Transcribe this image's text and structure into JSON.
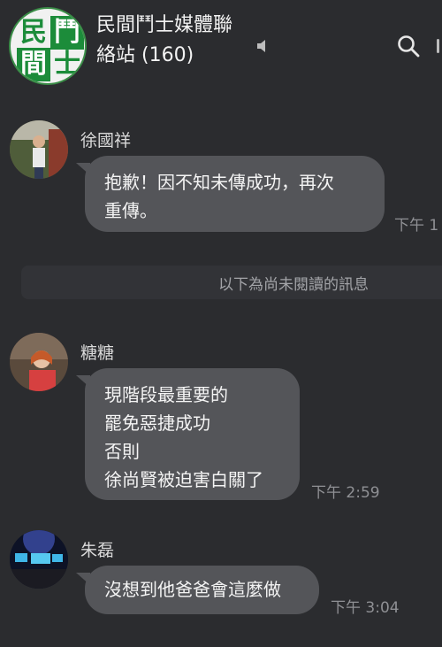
{
  "header": {
    "logo_chars": [
      "民",
      "鬥",
      "間",
      "士"
    ],
    "group_name_line1": "民間鬥士媒體聯",
    "group_name_line2": "絡站",
    "member_count": "(160)",
    "icons": [
      "speaker-muted-icon",
      "search-icon"
    ]
  },
  "unread_divider": "以下為尚未閱讀的訊息",
  "messages": [
    {
      "sender": "徐國祥",
      "lines": [
        "抱歉！因不知未傳成功，再次",
        "重傳。"
      ],
      "time": "下午 1"
    },
    {
      "sender": "糖糖",
      "lines": [
        "現階段最重要的",
        "罷免惡捷成功",
        "否則",
        "徐尚賢被迫害白關了"
      ],
      "time": "下午 2:59"
    },
    {
      "sender": "朱磊",
      "lines": [
        "沒想到他爸爸會這麼做"
      ],
      "time": "下午 3:04"
    }
  ],
  "colors": {
    "background": "#2b2c2f",
    "bubble": "#545559",
    "logo_green": "#1c8c3a"
  }
}
